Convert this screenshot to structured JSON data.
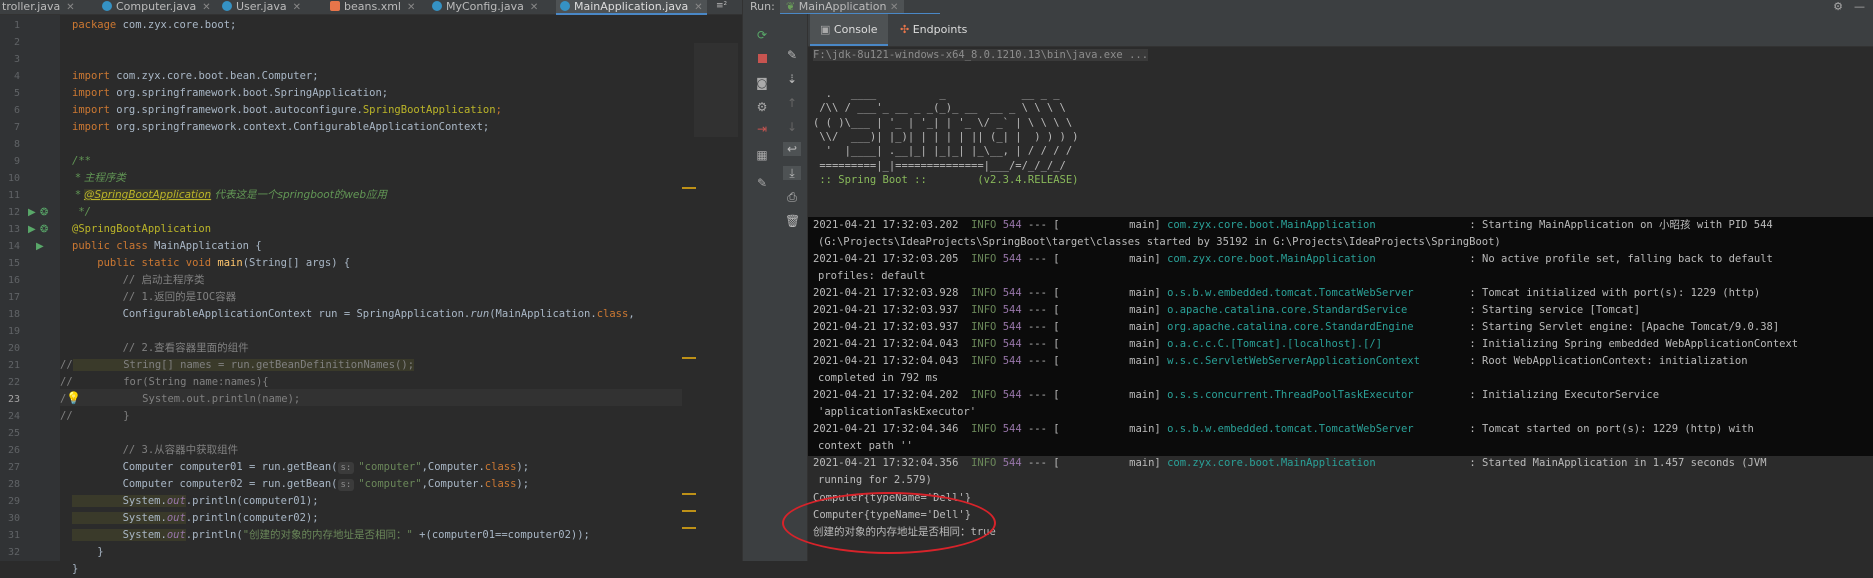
{
  "editor": {
    "tabs": [
      {
        "label": "troller.java",
        "type": "java"
      },
      {
        "label": "Computer.java",
        "type": "java"
      },
      {
        "label": "User.java",
        "type": "java"
      },
      {
        "label": "beans.xml",
        "type": "xml"
      },
      {
        "label": "MyConfig.java",
        "type": "java"
      },
      {
        "label": "MainApplication.java",
        "type": "java",
        "active": true
      }
    ],
    "tab_overflow": "≡²",
    "line_numbers": [
      "1",
      "2",
      "3",
      "4",
      "5",
      "6",
      "7",
      "8",
      "9",
      "10",
      "11",
      "12",
      "13",
      "14",
      "15",
      "16",
      "17",
      "18",
      "19",
      "20",
      "21",
      "22",
      "23",
      "24",
      "25",
      "26",
      "27",
      "28",
      "29",
      "30",
      "31",
      "32"
    ],
    "current_line": 23,
    "code": {
      "l1_kw": "package",
      "l1_rest": " com.zyx.core.boot;",
      "l3_kw": "import",
      "l3_rest": " com.zyx.core.boot.bean.Computer;",
      "l4_kw": "import",
      "l4_rest": " org.springframework.boot.SpringApplication;",
      "l5_kw": "import",
      "l5_rest": " org.springframework.boot.autoconfigure.",
      "l5_ann": "SpringBootApplication",
      "l5_end": ";",
      "l6_kw": "import",
      "l6_rest": " org.springframework.context.ConfigurableApplicationContext;",
      "l8": "/**",
      "l9": " * 主程序类",
      "l10_pre": " * ",
      "l10_tag": "@SpringBootApplication",
      "l10_post": " 代表这是一个springboot的web应用",
      "l11": " */",
      "l12": "@SpringBootApplication",
      "l13_kw": "public class",
      "l13_rest": " MainApplication {",
      "l14_kw": "    public static void",
      "l14_fn": " main",
      "l14_rest": "(String[] args) {",
      "l15": "        // 启动主程序类",
      "l16": "        // 1.返回的是IOC容器",
      "l17_a": "        ConfigurableApplicationContext run = SpringApplication.",
      "l17_fn": "run",
      "l17_b": "(MainApplication.",
      "l17_kw": "class",
      "l17_c": ",",
      "l19": "        // 2.查看容器里面的组件",
      "l20_cm": "//",
      "l20_code": "        String[] names = run.getBeanDefinitionNames();",
      "l21_cm": "//",
      "l21_code": "        for(String name:names){",
      "l22_cm": "/",
      "l22_code": "            System.out.println(name);",
      "l23_cm": "//",
      "l23_code": "        }",
      "l25": "        // 3.从容器中获取组件",
      "l26_a": "        Computer computer01 = run.getBean(",
      "l26_hint": "s:",
      "l26_str": "\"computer\"",
      "l26_b": ",Computer.",
      "l26_kw": "class",
      "l26_c": ");",
      "l27_a": "        Computer computer02 = run.getBean(",
      "l27_hint": "s:",
      "l27_str": "\"computer\"",
      "l27_b": ",Computer.",
      "l27_kw": "class",
      "l27_c": ");",
      "l28_a": "        System.",
      "l28_fld": "out",
      "l28_b": ".println(computer01);",
      "l29_a": "        System.",
      "l29_fld": "out",
      "l29_b": ".println(computer02);",
      "l30_a": "        System.",
      "l30_fld": "out",
      "l30_b": ".println(",
      "l30_str": "\"创建的对象的内存地址是否相同：\"",
      "l30_c": " +(computer01==computer02));",
      "l31": "    }",
      "l32": "}"
    }
  },
  "run": {
    "label": "Run:",
    "config_name": "MainApplication",
    "tabs": {
      "console": "Console",
      "endpoints": "Endpoints"
    }
  },
  "console": {
    "command": "F:\\jdk-8u121-windows-x64_8.0.1210.13\\bin\\java.exe ...",
    "banner": [
      "  .   ____          _            __ _ _",
      " /\\\\ / ___'_ __ _ _(_)_ __  __ _ \\ \\ \\ \\",
      "( ( )\\___ | '_ | '_| | '_ \\/ _` | \\ \\ \\ \\",
      " \\\\/  ___)| |_)| | | | | || (_| |  ) ) ) )",
      "  '  |____| .__|_| |_|_| |_\\__, | / / / /",
      " =========|_|==============|___/=/_/_/_/",
      " :: Spring Boot ::        (v2.3.4.RELEASE)"
    ],
    "logs": [
      {
        "ts": "2021-04-21 17:32:03.202",
        "level": "INFO",
        "pid": "544",
        "thread": "main",
        "logger": "com.zyx.core.boot.MainApplication",
        "msg": "Starting MainApplication on 小昭孩 with PID 544",
        "cont": "(G:\\Projects\\IdeaProjects\\SpringBoot\\target\\classes started by 35192 in G:\\Projects\\IdeaProjects\\SpringBoot)"
      },
      {
        "ts": "2021-04-21 17:32:03.205",
        "level": "INFO",
        "pid": "544",
        "thread": "main",
        "logger": "com.zyx.core.boot.MainApplication",
        "msg": "No active profile set, falling back to default",
        "cont": "profiles: default"
      },
      {
        "ts": "2021-04-21 17:32:03.928",
        "level": "INFO",
        "pid": "544",
        "thread": "main",
        "logger": "o.s.b.w.embedded.tomcat.TomcatWebServer",
        "msg": "Tomcat initialized with port(s): 1229 (http)",
        "cont": ""
      },
      {
        "ts": "2021-04-21 17:32:03.937",
        "level": "INFO",
        "pid": "544",
        "thread": "main",
        "logger": "o.apache.catalina.core.StandardService",
        "msg": "Starting service [Tomcat]",
        "cont": ""
      },
      {
        "ts": "2021-04-21 17:32:03.937",
        "level": "INFO",
        "pid": "544",
        "thread": "main",
        "logger": "org.apache.catalina.core.StandardEngine",
        "msg": "Starting Servlet engine: [Apache Tomcat/9.0.38]",
        "cont": ""
      },
      {
        "ts": "2021-04-21 17:32:04.043",
        "level": "INFO",
        "pid": "544",
        "thread": "main",
        "logger": "o.a.c.c.C.[Tomcat].[localhost].[/]",
        "msg": "Initializing Spring embedded WebApplicationContext",
        "cont": ""
      },
      {
        "ts": "2021-04-21 17:32:04.043",
        "level": "INFO",
        "pid": "544",
        "thread": "main",
        "logger": "w.s.c.ServletWebServerApplicationContext",
        "msg": "Root WebApplicationContext: initialization",
        "cont": "completed in 792 ms"
      },
      {
        "ts": "2021-04-21 17:32:04.202",
        "level": "INFO",
        "pid": "544",
        "thread": "main",
        "logger": "o.s.s.concurrent.ThreadPoolTaskExecutor",
        "msg": "Initializing ExecutorService",
        "cont": "'applicationTaskExecutor'"
      },
      {
        "ts": "2021-04-21 17:32:04.346",
        "level": "INFO",
        "pid": "544",
        "thread": "main",
        "logger": "o.s.b.w.embedded.tomcat.TomcatWebServer",
        "msg": "Tomcat started on port(s): 1229 (http) with",
        "cont": "context path ''"
      },
      {
        "ts": "2021-04-21 17:32:04.356",
        "level": "INFO",
        "pid": "544",
        "thread": "main",
        "logger": "com.zyx.core.boot.MainApplication",
        "msg": "Started MainApplication in 1.457 seconds (JVM",
        "cont": "running for 2.579)"
      }
    ],
    "output": [
      "Computer{typeName='Dell'}",
      "Computer{typeName='Dell'}",
      "创建的对象的内存地址是否相同：true"
    ]
  },
  "colors": {
    "annotation_circle": "#d8232a",
    "accent": "#4a88c7"
  }
}
